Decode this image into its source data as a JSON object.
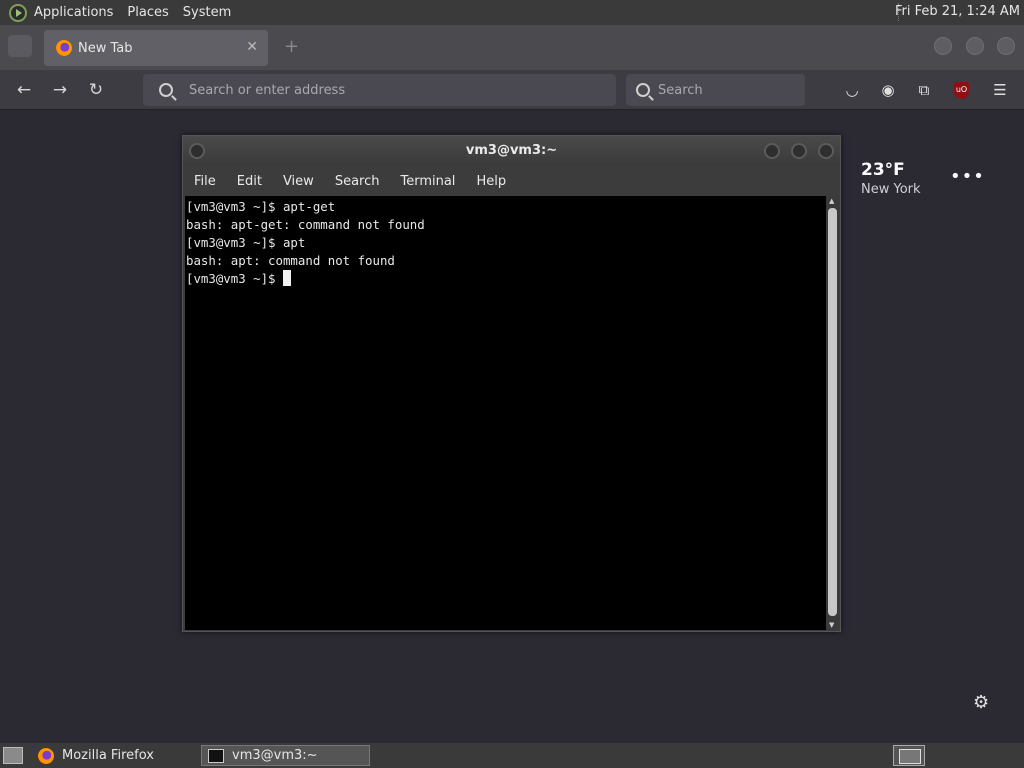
{
  "top_panel": {
    "menus": [
      "Applications",
      "Places",
      "System"
    ],
    "clock": "Fri Feb 21, 1:24 AM"
  },
  "browser": {
    "tab_title": "New Tab",
    "url_placeholder": "Search or enter address",
    "search_placeholder": "Search",
    "weather": {
      "temp": "23°F",
      "city": "New York"
    }
  },
  "terminal": {
    "title": "vm3@vm3:~",
    "menu": [
      "File",
      "Edit",
      "View",
      "Search",
      "Terminal",
      "Help"
    ],
    "lines": [
      "[vm3@vm3 ~]$ apt-get",
      "bash: apt-get: command not found",
      "[vm3@vm3 ~]$ apt",
      "bash: apt: command not found",
      "[vm3@vm3 ~]$ "
    ]
  },
  "taskbar": {
    "items": [
      {
        "label": "Mozilla Firefox",
        "active": false
      },
      {
        "label": "vm3@vm3:~",
        "active": true
      }
    ]
  },
  "colors": {
    "page_bg": "#2b2a33",
    "terminal_bg": "#000000",
    "panel_bg": "#3a3a3a"
  }
}
